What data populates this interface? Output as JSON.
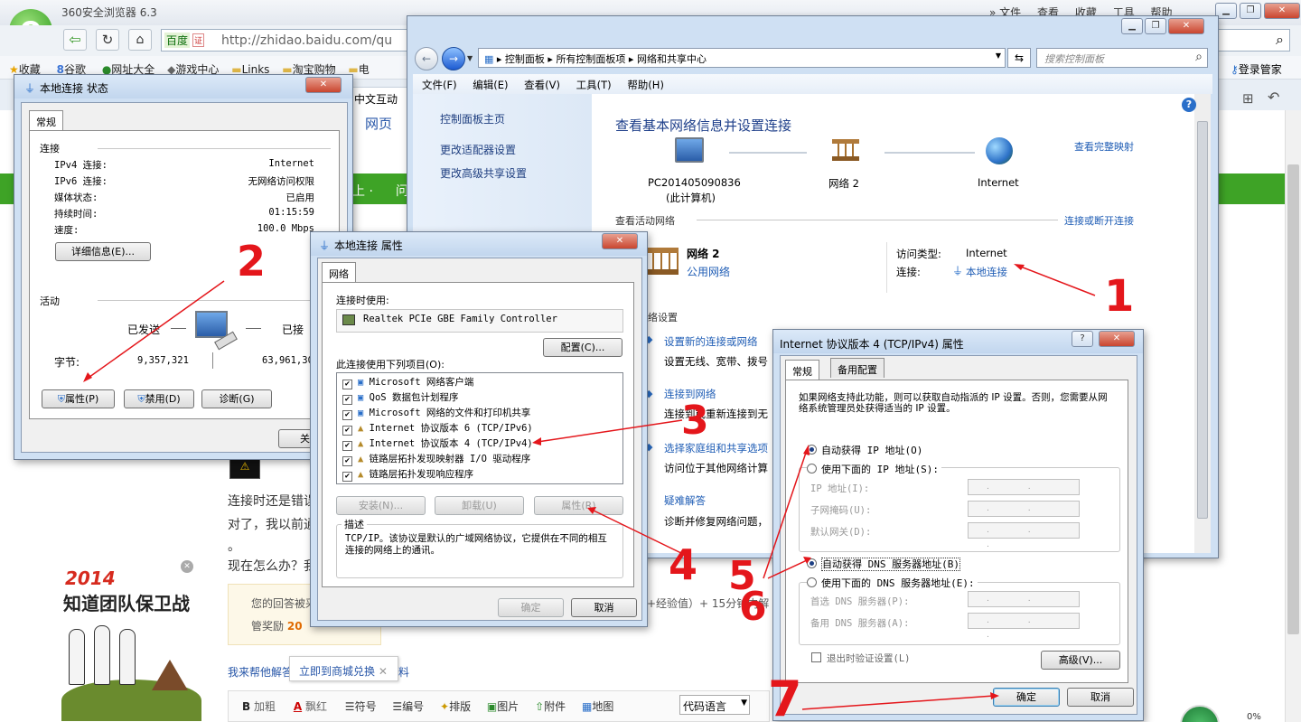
{
  "browser": {
    "title": "360安全浏览器 6.3",
    "url": "http://zhidao.baidu.com/qu",
    "search_engine": "百度",
    "search_badge": "证",
    "menu": [
      "文件",
      "查看",
      "收藏",
      "工具",
      "帮助"
    ],
    "bookmarks": [
      "收藏",
      "谷歌",
      "网址大全",
      "游戏中心",
      "Links",
      "淘宝购物",
      "电"
    ],
    "login": "登录管家"
  },
  "page": {
    "tab_label": "中文互动",
    "nav_web": "网页",
    "nav_more": "上 ·",
    "nav_q": "问",
    "text1": "连接时还是错误",
    "text2": "对了，我以前通",
    "text3": "。",
    "text4": "现在怎么办？我",
    "notice1": "您的回答被采",
    "notice2": "管奖励",
    "notice_num": "20",
    "notice_right": "+经验值）+ 15分钟内解",
    "help_text": "我来帮他解答",
    "redeem_btn": "立即到商城兑换",
    "help_tail": "料",
    "promo_year": "2014",
    "promo_title": "知道团队保卫战",
    "toolbar": [
      "加粗",
      "飘红",
      "符号",
      "编号",
      "排版",
      "图片",
      "附件",
      "地图"
    ],
    "code_lang": "代码语言",
    "status_pct": "0%"
  },
  "status_win": {
    "title": "本地连接 状态",
    "tab": "常规",
    "sec_conn": "连接",
    "rows": [
      {
        "k": "IPv4 连接:",
        "v": "Internet"
      },
      {
        "k": "IPv6 连接:",
        "v": "无网络访问权限"
      },
      {
        "k": "媒体状态:",
        "v": "已启用"
      },
      {
        "k": "持续时间:",
        "v": "01:15:59"
      },
      {
        "k": "速度:",
        "v": "100.0 Mbps"
      }
    ],
    "details_btn": "详细信息(E)...",
    "sec_act": "活动",
    "sent": "已发送",
    "recv": "已接",
    "bytes_label": "字节:",
    "bytes_sent": "9,357,321",
    "bytes_recv": "63,961,30",
    "prop_btn": "属性(P)",
    "disable_btn": "禁用(D)",
    "diag_btn": "诊断(G)",
    "close_btn": "关闭"
  },
  "cpanel": {
    "crumbs": [
      "控制面板",
      "所有控制面板项",
      "网络和共享中心"
    ],
    "search_ph": "搜索控制面板",
    "menu": [
      "文件(F)",
      "编辑(E)",
      "查看(V)",
      "工具(T)",
      "帮助(H)"
    ],
    "side": [
      "控制面板主页",
      "更改适配器设置",
      "更改高级共享设置"
    ],
    "heading": "查看基本网络信息并设置连接",
    "full_map": "查看完整映射",
    "node_pc": "PC201405090836",
    "node_pc_sub": "(此计算机)",
    "node_net": "网络 2",
    "node_inet": "Internet",
    "active_title": "查看活动网络",
    "connect_link": "连接或断开连接",
    "net_name": "网络 2",
    "net_type": "公用网络",
    "access_label": "访问类型:",
    "access_value": "Internet",
    "conn_label": "连接:",
    "conn_value": "本地连接",
    "change_title": "络设置",
    "tasks": [
      {
        "t": "设置新的连接或网络",
        "d": "设置无线、宽带、拨号"
      },
      {
        "t": "连接到网络",
        "d": "连接到或重新连接到无"
      },
      {
        "t": "选择家庭组和共享选项",
        "d": "访问位于其他网络计算"
      },
      {
        "t": "疑难解答",
        "d": "诊断并修复网络问题，"
      }
    ]
  },
  "props_win": {
    "title": "本地连接 属性",
    "tab": "网络",
    "connect_using": "连接时使用:",
    "adapter": "Realtek PCIe GBE Family Controller",
    "config_btn": "配置(C)...",
    "items_label": "此连接使用下列项目(O):",
    "items": [
      "Microsoft 网络客户端",
      "QoS 数据包计划程序",
      "Microsoft 网络的文件和打印机共享",
      "Internet 协议版本 6 (TCP/IPv6)",
      "Internet 协议版本 4 (TCP/IPv4)",
      "链路层拓扑发现映射器 I/O 驱动程序",
      "链路层拓扑发现响应程序"
    ],
    "install_btn": "安装(N)...",
    "uninstall_btn": "卸载(U)",
    "props_btn": "属性(R)",
    "desc_title": "描述",
    "desc_text": "TCP/IP。该协议是默认的广域网络协议，它提供在不同的相互连接的网络上的通讯。",
    "ok": "确定",
    "cancel": "取消"
  },
  "ipv4_win": {
    "title": "Internet 协议版本 4 (TCP/IPv4) 属性",
    "tabs": [
      "常规",
      "备用配置"
    ],
    "intro": "如果网络支持此功能，则可以获取自动指派的 IP 设置。否则，您需要从网络系统管理员处获得适当的 IP 设置。",
    "auto_ip": "自动获得 IP 地址(O)",
    "manual_ip": "使用下面的 IP 地址(S):",
    "ip_fields": [
      "IP 地址(I):",
      "子网掩码(U):",
      "默认网关(D):"
    ],
    "auto_dns": "自动获得 DNS 服务器地址(B)",
    "manual_dns": "使用下面的 DNS 服务器地址(E):",
    "dns_fields": [
      "首选 DNS 服务器(P):",
      "备用 DNS 服务器(A):"
    ],
    "validate": "退出时验证设置(L)",
    "advanced_btn": "高级(V)...",
    "ok": "确定",
    "cancel": "取消",
    "ip_dots": ". . ."
  },
  "annotations": [
    "1",
    "2",
    "3",
    "4",
    "5",
    "6",
    "7"
  ],
  "colors": {
    "accent_green": "#3ea326",
    "annotation_red": "#e4161b",
    "link_blue": "#1f5db5"
  }
}
